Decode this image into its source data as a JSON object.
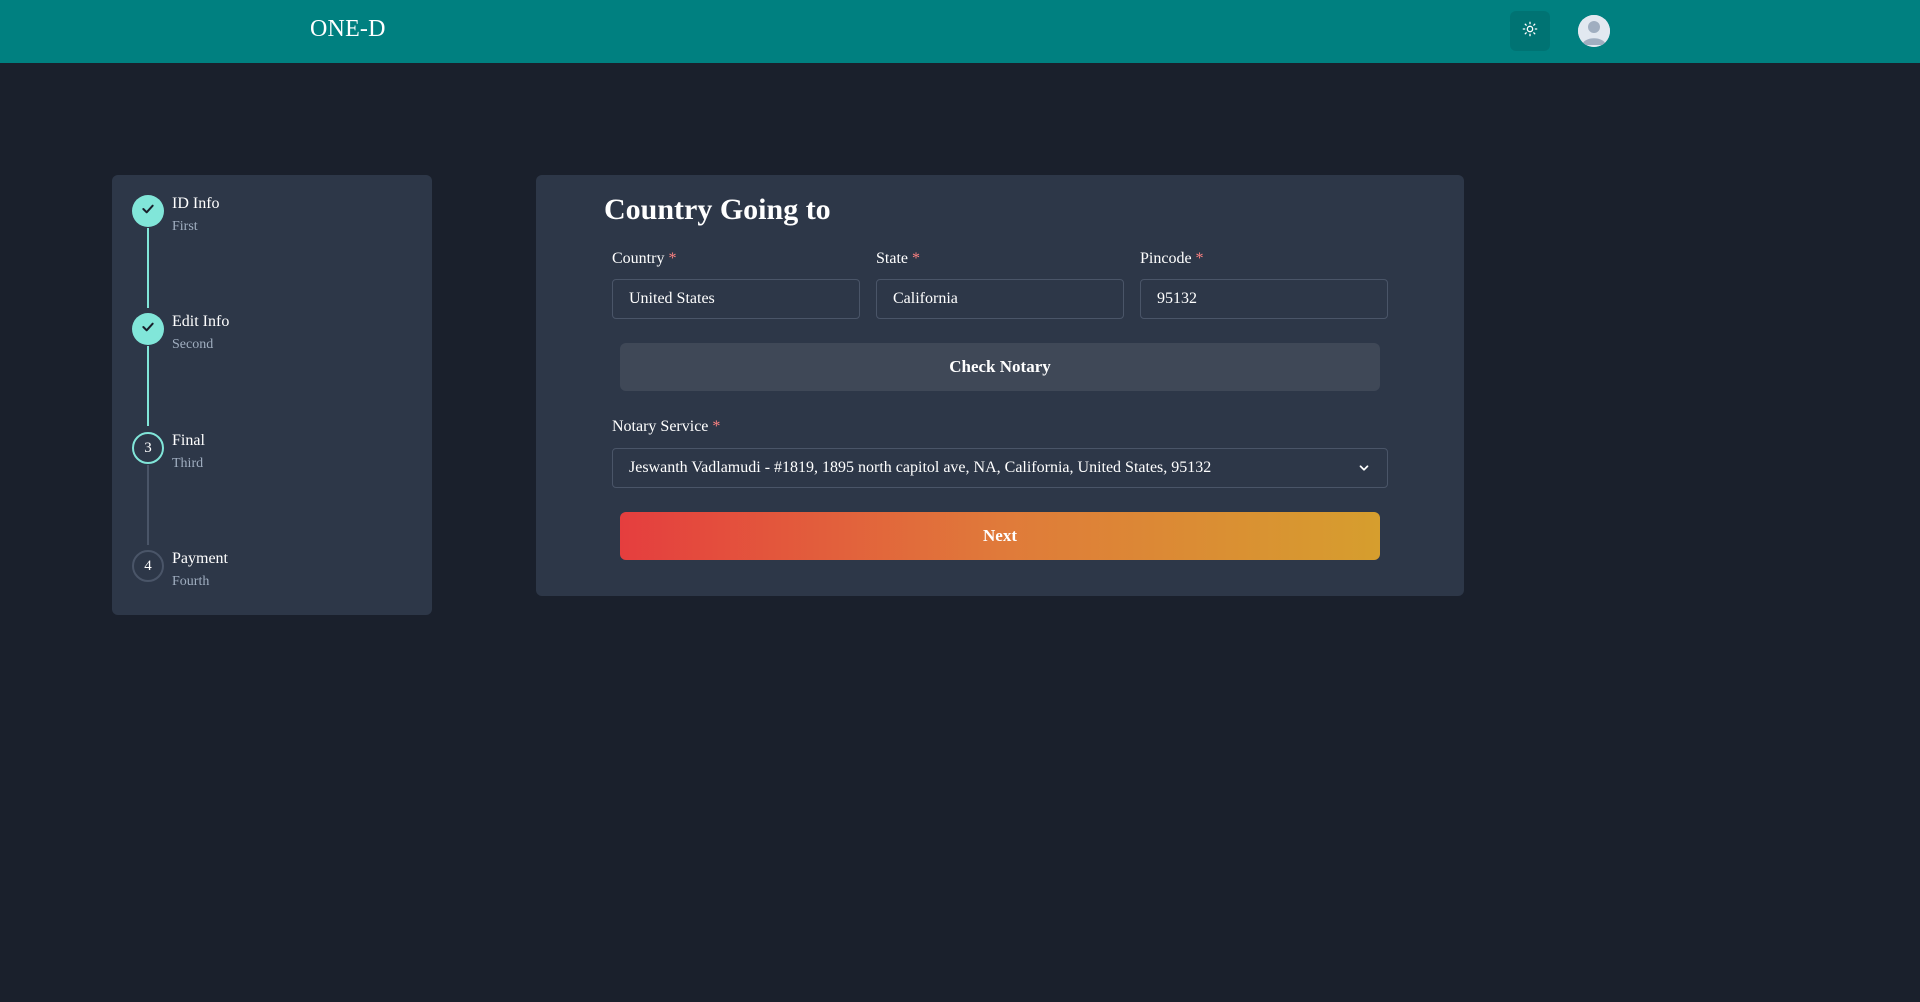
{
  "header": {
    "brand": "ONE-D",
    "theme_icon": "sun-icon",
    "avatar_icon": "user-avatar-icon",
    "background_color": "#008080"
  },
  "stepper": {
    "steps": [
      {
        "title": "ID Info",
        "subtitle": "First",
        "status": "complete",
        "marker": "check-icon"
      },
      {
        "title": "Edit Info",
        "subtitle": "Second",
        "status": "complete",
        "marker": "check-icon"
      },
      {
        "title": "Final",
        "subtitle": "Third",
        "status": "active",
        "marker": "3"
      },
      {
        "title": "Payment",
        "subtitle": "Fourth",
        "status": "incomplete",
        "marker": "4"
      }
    ],
    "accent_color": "#81e6d9"
  },
  "form": {
    "title": "Country Going to",
    "required_mark": "*",
    "country": {
      "label": "Country",
      "value": "United States"
    },
    "state": {
      "label": "State",
      "value": "California"
    },
    "pincode": {
      "label": "Pincode",
      "value": "95132"
    },
    "check_button": "Check Notary",
    "notary": {
      "label": "Notary Service",
      "selected": "Jeswanth Vadlamudi - #1819, 1895 north capitol ave, NA, California, United States, 95132"
    },
    "next_button": "Next"
  }
}
